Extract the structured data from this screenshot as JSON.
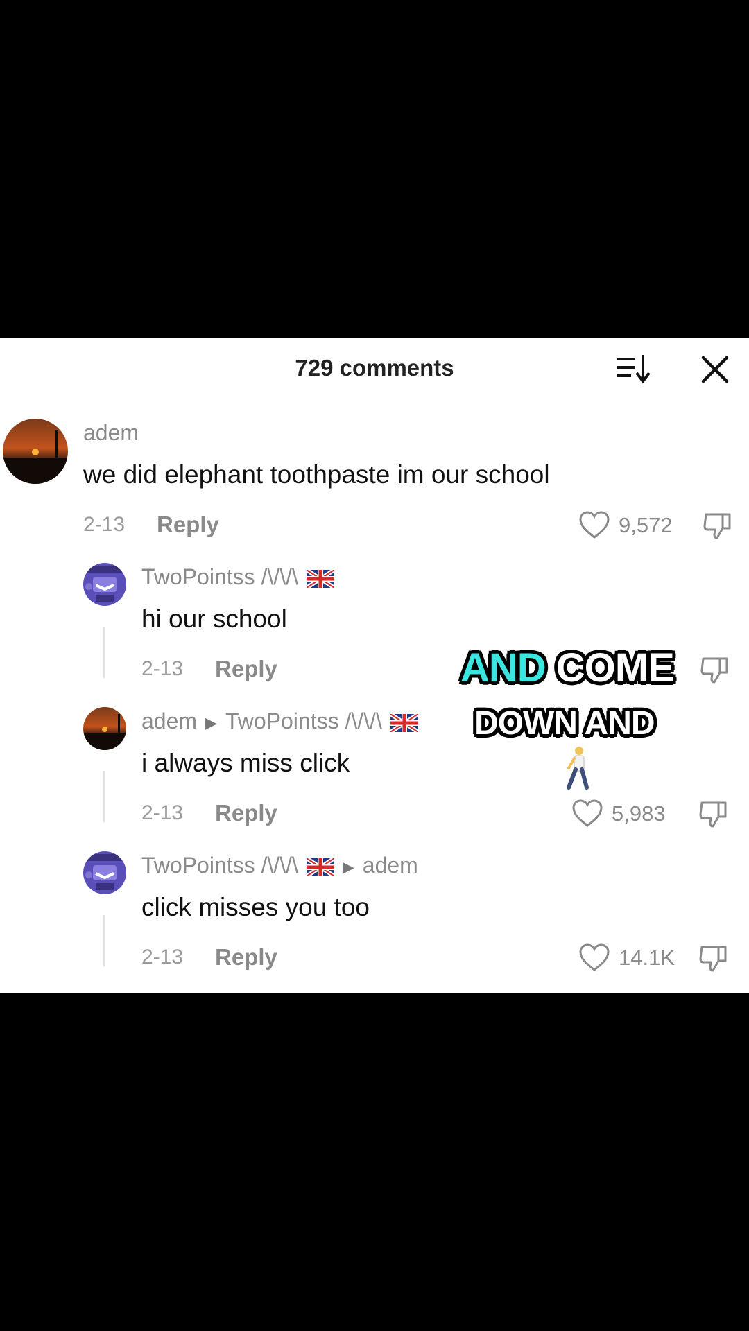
{
  "header": {
    "title": "729 comments"
  },
  "comments": [
    {
      "username": "adem",
      "text": "we did elephant toothpaste im our school",
      "date": "2-13",
      "reply_label": "Reply",
      "likes": "9,572"
    },
    {
      "username": "TwoPointss /\\/\\/\\",
      "flag": "uk-flag-icon",
      "text": "hi our school",
      "date": "2-13",
      "reply_label": "Reply"
    },
    {
      "username": "adem",
      "reply_to": "TwoPointss /\\/\\/\\",
      "reply_to_flag": "uk-flag-icon",
      "text": "i always miss click",
      "date": "2-13",
      "reply_label": "Reply",
      "likes": "5,983"
    },
    {
      "username": "TwoPointss /\\/\\/\\",
      "flag": "uk-flag-icon",
      "reply_to": "adem",
      "text": "click misses you too",
      "date": "2-13",
      "reply_label": "Reply",
      "likes": "14.1K"
    }
  ],
  "caption": {
    "line1_highlight": "AND",
    "line1_rest": "COME",
    "line2": "DOWN AND",
    "emoji": "person-walking-icon",
    "highlight_color": "#3be6e0"
  }
}
